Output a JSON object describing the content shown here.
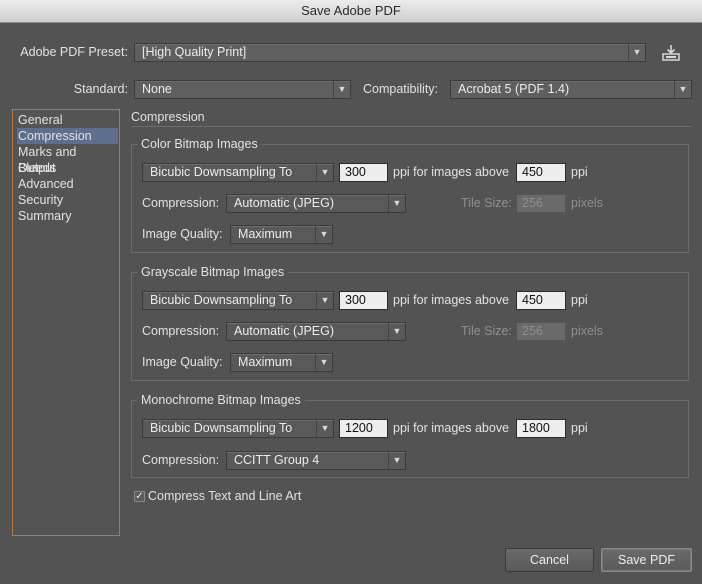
{
  "window": {
    "title": "Save Adobe PDF"
  },
  "header": {
    "preset_label": "Adobe PDF Preset:",
    "preset_value": "[High Quality Print]",
    "standard_label": "Standard:",
    "standard_value": "None",
    "compat_label": "Compatibility:",
    "compat_value": "Acrobat 5 (PDF 1.4)"
  },
  "sidebar": {
    "items": [
      {
        "label": "General"
      },
      {
        "label": "Compression"
      },
      {
        "label": "Marks and Bleeds"
      },
      {
        "label": "Output"
      },
      {
        "label": "Advanced"
      },
      {
        "label": "Security"
      },
      {
        "label": "Summary"
      }
    ],
    "selected": "Compression"
  },
  "main": {
    "section_title": "Compression",
    "color": {
      "title": "Color Bitmap Images",
      "sampling": "Bicubic Downsampling To",
      "ppi": "300",
      "above_label": "ppi for images above",
      "above": "450",
      "ppi_unit": "ppi",
      "compression_label": "Compression:",
      "compression": "Automatic (JPEG)",
      "tile_label": "Tile Size:",
      "tile": "256",
      "pixels_label": "pixels",
      "quality_label": "Image Quality:",
      "quality": "Maximum"
    },
    "gray": {
      "title": "Grayscale Bitmap Images",
      "sampling": "Bicubic Downsampling To",
      "ppi": "300",
      "above_label": "ppi for images above",
      "above": "450",
      "ppi_unit": "ppi",
      "compression_label": "Compression:",
      "compression": "Automatic (JPEG)",
      "tile_label": "Tile Size:",
      "tile": "256",
      "pixels_label": "pixels",
      "quality_label": "Image Quality:",
      "quality": "Maximum"
    },
    "mono": {
      "title": "Monochrome Bitmap Images",
      "sampling": "Bicubic Downsampling To",
      "ppi": "1200",
      "above_label": "ppi for images above",
      "above": "1800",
      "ppi_unit": "ppi",
      "compression_label": "Compression:",
      "compression": "CCITT Group 4"
    },
    "compress_text_label": "Compress Text and Line Art",
    "compress_text_checked": true
  },
  "footer": {
    "cancel_label": "Cancel",
    "save_label": "Save PDF"
  },
  "icons": {
    "arrow": "▼",
    "check": "✓",
    "save_preset": "save-preset-icon"
  },
  "colors": {
    "background": "#535353",
    "selection": "#5d6f8c",
    "sidebar_border": "#b8773a"
  }
}
